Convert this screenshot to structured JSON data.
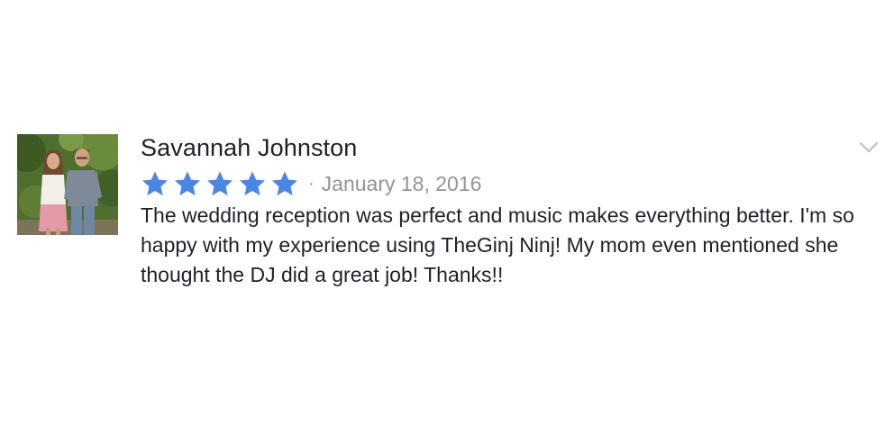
{
  "review": {
    "reviewer_name": "Savannah Johnston",
    "rating": 5,
    "rating_max": 5,
    "separator": "·",
    "date": "January 18, 2016",
    "text": "The wedding reception was perfect and music makes everything better. I'm so happy with my experience using TheGinj Ninj! My mom even mentioned she thought the DJ did a great job! Thanks!!",
    "avatar_icon": "profile-photo",
    "star_icon": "star-icon",
    "menu_icon": "chevron-down-icon"
  },
  "colors": {
    "star": "#4a86e8",
    "date": "#90949c",
    "text": "#1d2129",
    "chevron": "#c4c7cc"
  }
}
